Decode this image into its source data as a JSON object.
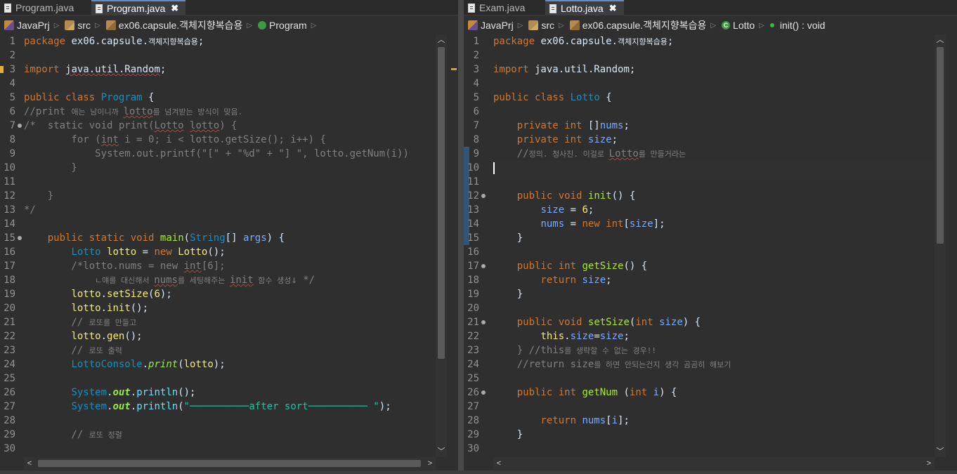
{
  "left": {
    "tabs": [
      {
        "label": "Program.java",
        "active": false
      },
      {
        "label": "Program.java",
        "active": true,
        "close": "✖"
      }
    ],
    "breadcrumb": [
      "JavaPrj",
      "src",
      "ex06.capsule.객체지향복습용",
      "Program"
    ],
    "lines": [
      "1",
      "2",
      "3",
      "4",
      "5",
      "6",
      "7",
      "8",
      "9",
      "10",
      "11",
      "12",
      "13",
      "14",
      "15",
      "16",
      "17",
      "18",
      "19",
      "20",
      "21",
      "22",
      "23",
      "24",
      "25",
      "26",
      "27",
      "28",
      "29",
      "30"
    ],
    "code": {
      "l1_a": "package",
      "l1_b": " ex06.capsule.",
      "l1_c": "객체지향복습용",
      "l1_d": ";",
      "l3_a": "import",
      "l3_b": " ",
      "l3_c": "java.util.Random",
      "l3_d": ";",
      "l5_a": "public",
      "l5_b": " ",
      "l5_c": "class",
      "l5_d": " ",
      "l5_e": "Program",
      "l5_f": " {",
      "l6_a": "//print ",
      "l6_b": "애는 남이니까 ",
      "l6_c": "lotto",
      "l6_d": "를 넘겨받는 방식이 맞음.",
      "l7_a": "/*  static void print(",
      "l7_b": "Lotto",
      "l7_c": " ",
      "l7_d": "lotto",
      "l7_e": ") {",
      "l8_a": "        for (",
      "l8_b": "int",
      "l8_c": " i = 0; i < lotto.getSize(); i++) {",
      "l9": "            System.out.printf(\"[\" + \"%d\" + \"] \", lotto.getNum(i))",
      "l10": "        }",
      "l12": "    }",
      "l13": "*/",
      "l15_a": "    public",
      "l15_b": " static",
      "l15_c": " void",
      "l15_d": " ",
      "l15_e": "main",
      "l15_f": "(",
      "l15_g": "String",
      "l15_h": "[] ",
      "l15_i": "args",
      "l15_j": ") {",
      "l16_a": "        ",
      "l16_b": "Lotto",
      "l16_c": " ",
      "l16_d": "lotto",
      "l16_e": " = ",
      "l16_f": "new",
      "l16_g": " ",
      "l16_h": "Lotto",
      "l16_i": "();",
      "l17_a": "        /*lotto.nums = new ",
      "l17_b": "int",
      "l17_c": "[6];",
      "l18_a": "            ",
      "l18_b": "ㄴ얘를 대신해서 ",
      "l18_c": "nums",
      "l18_d": "를 세팅해주는 ",
      "l18_e": "init",
      "l18_f": " 함수 생성",
      "l18_g": "↓ */",
      "l19_a": "        ",
      "l19_b": "lotto",
      "l19_c": ".",
      "l19_d": "setSize",
      "l19_e": "(",
      "l19_f": "6",
      "l19_g": ");",
      "l20_a": "        ",
      "l20_b": "lotto",
      "l20_c": ".",
      "l20_d": "init",
      "l20_e": "();",
      "l21_a": "        // ",
      "l21_b": "로또를 만들고",
      "l22_a": "        ",
      "l22_b": "lotto",
      "l22_c": ".",
      "l22_d": "gen",
      "l22_e": "();",
      "l23_a": "        // ",
      "l23_b": "로또 출력",
      "l24_a": "        ",
      "l24_b": "LottoConsole",
      "l24_c": ".",
      "l24_d": "print",
      "l24_e": "(",
      "l24_f": "lotto",
      "l24_g": ");",
      "l26_a": "        ",
      "l26_b": "System",
      "l26_c": ".",
      "l26_d": "out",
      "l26_e": ".",
      "l26_f": "println",
      "l26_g": "();",
      "l27_a": "        ",
      "l27_b": "System",
      "l27_c": ".",
      "l27_d": "out",
      "l27_e": ".",
      "l27_f": "println",
      "l27_g": "(",
      "l27_h": "\"──────────after sort────────── \"",
      "l27_i": ");",
      "l29_a": "        // ",
      "l29_b": "로또 정렬"
    }
  },
  "right": {
    "tabs": [
      {
        "label": "Exam.java",
        "active": false
      },
      {
        "label": "Lotto.java",
        "active": true,
        "close": "✖"
      }
    ],
    "breadcrumb": [
      "JavaPrj",
      "src",
      "ex06.capsule.객체지향복습용",
      "Lotto",
      "init() : void"
    ],
    "class_icon_letter": "C",
    "lines": [
      "1",
      "2",
      "3",
      "4",
      "5",
      "6",
      "7",
      "8",
      "9",
      "10",
      "11",
      "12",
      "13",
      "14",
      "15",
      "16",
      "17",
      "18",
      "19",
      "20",
      "21",
      "22",
      "23",
      "24",
      "25",
      "26",
      "27",
      "28",
      "29",
      "30"
    ],
    "code": {
      "l1_a": "package",
      "l1_b": " ex06.capsule.",
      "l1_c": "객체지향복습용",
      "l1_d": ";",
      "l3_a": "import",
      "l3_b": " java.util.Random;",
      "l5_a": "public",
      "l5_b": " ",
      "l5_c": "class",
      "l5_d": " ",
      "l5_e": "Lotto",
      "l5_f": " {",
      "l7_a": "    private",
      "l7_b": " ",
      "l7_c": "int",
      "l7_d": " []",
      "l7_e": "nums",
      "l7_f": ";",
      "l8_a": "    private",
      "l8_b": " ",
      "l8_c": "int",
      "l8_d": " ",
      "l8_e": "size",
      "l8_f": ";",
      "l9_a": "    //",
      "l9_b": "정의. 청사진. 이걸로 ",
      "l9_c": "Lotto",
      "l9_d": "를 만들거라는",
      "l12_a": "    public",
      "l12_b": " ",
      "l12_c": "void",
      "l12_d": " ",
      "l12_e": "init",
      "l12_f": "() {",
      "l13_a": "        ",
      "l13_b": "size",
      "l13_c": " = ",
      "l13_d": "6",
      "l13_e": ";",
      "l14_a": "        ",
      "l14_b": "nums",
      "l14_c": " = ",
      "l14_d": "new",
      "l14_e": " ",
      "l14_f": "int",
      "l14_g": "[",
      "l14_h": "size",
      "l14_i": "];",
      "l15": "    }",
      "l17_a": "    public",
      "l17_b": " ",
      "l17_c": "int",
      "l17_d": " ",
      "l17_e": "getSize",
      "l17_f": "() {",
      "l18_a": "        return",
      "l18_b": " ",
      "l18_c": "size",
      "l18_d": ";",
      "l19": "    }",
      "l21_a": "    public",
      "l21_b": " ",
      "l21_c": "void",
      "l21_d": " ",
      "l21_e": "setSize",
      "l21_f": "(",
      "l21_g": "int",
      "l21_h": " ",
      "l21_i": "size",
      "l21_j": ") {",
      "l22_a": "        ",
      "l22_b": "this",
      "l22_c": ".",
      "l22_d": "size",
      "l22_e": "=",
      "l22_f": "size",
      "l22_g": ";",
      "l23_a": "    } //this",
      "l23_b": "를 생략할 수 없는 경우!!",
      "l24_a": "    //return size",
      "l24_b": "를 하면 안되는건지 생각 곰곰히 해보기",
      "l26_a": "    public",
      "l26_b": " ",
      "l26_c": "int",
      "l26_d": " ",
      "l26_e": "getNum",
      "l26_f": " (",
      "l26_g": "int",
      "l26_h": " ",
      "l26_i": "i",
      "l26_j": ") {",
      "l28_a": "        return",
      "l28_b": " ",
      "l28_c": "nums",
      "l28_d": "[",
      "l28_e": "i",
      "l28_f": "];",
      "l29": "    }"
    }
  },
  "scroll_glyphs": {
    "up": "︿",
    "down": "﹀",
    "left": "<",
    "right": ">"
  }
}
